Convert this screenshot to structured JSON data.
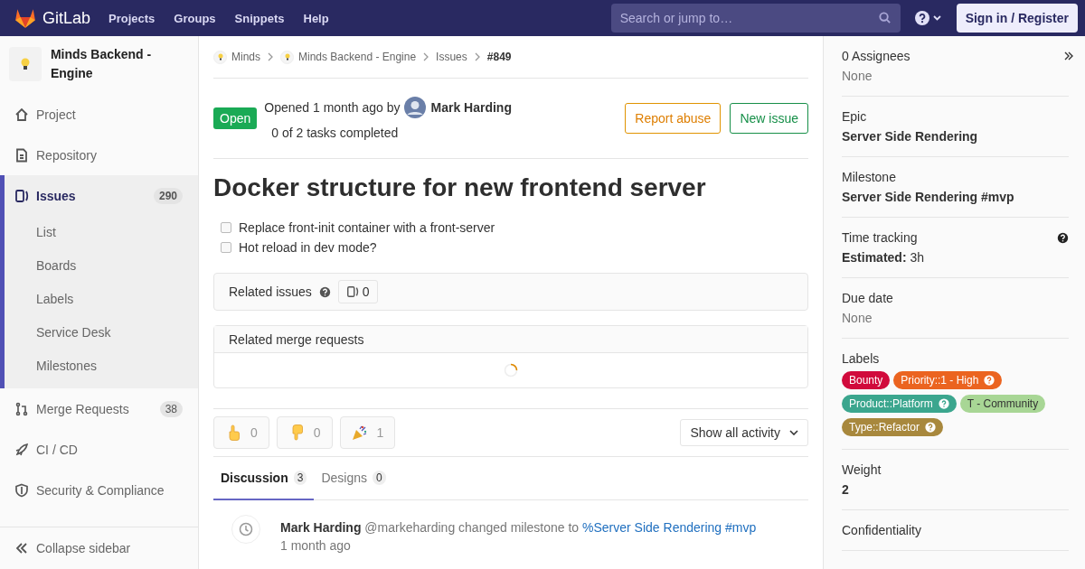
{
  "navbar": {
    "brand": "GitLab",
    "links": [
      "Projects",
      "Groups",
      "Snippets",
      "Help"
    ],
    "search": {
      "placeholder": "Search or jump to…"
    },
    "sign_in": "Sign in / Register"
  },
  "sidebar": {
    "project": "Minds Backend - Engine",
    "items": [
      {
        "label": "Project",
        "kind": "home",
        "selected": false
      },
      {
        "label": "Repository",
        "kind": "doc",
        "selected": false
      },
      {
        "label": "Issues",
        "kind": "issues",
        "selected": true,
        "count": "290",
        "children": [
          {
            "label": "List"
          },
          {
            "label": "Boards"
          },
          {
            "label": "Labels"
          },
          {
            "label": "Service Desk"
          },
          {
            "label": "Milestones"
          }
        ]
      },
      {
        "label": "Merge Requests",
        "kind": "merge",
        "selected": false,
        "count": "38"
      },
      {
        "label": "CI / CD",
        "kind": "rocket",
        "selected": false
      },
      {
        "label": "Security & Compliance",
        "kind": "shield",
        "selected": false
      }
    ],
    "collapse": "Collapse sidebar"
  },
  "breadcrumbs": [
    {
      "label": "Minds",
      "avatar": true
    },
    {
      "label": "Minds Backend - Engine",
      "avatar": true
    },
    {
      "label": "Issues",
      "avatar": false
    },
    {
      "label": "#849",
      "avatar": false
    }
  ],
  "issue": {
    "status": "Open",
    "opened": "Opened 1 month ago by",
    "author": "Mark Harding",
    "tasks_summary": "0 of 2 tasks completed",
    "buttons": [
      {
        "label": "Report abuse",
        "kind": "warning"
      },
      {
        "label": "New issue",
        "kind": "success"
      }
    ],
    "title": "Docker structure for new frontend server",
    "tasks": [
      {
        "label": "Replace front-init container with a front-server",
        "checked": false
      },
      {
        "label": "Hot reload in dev mode?",
        "checked": false
      }
    ]
  },
  "related_issues": {
    "title": "Related issues",
    "count": "0"
  },
  "related_merge_requests": {
    "title": "Related merge requests",
    "loading": true
  },
  "awards": [
    {
      "kind": "thumbsup",
      "count": "0"
    },
    {
      "kind": "thumbsdown",
      "count": "0"
    },
    {
      "kind": "tada",
      "count": "1"
    }
  ],
  "activity_filter": "Show all activity",
  "tabs": [
    {
      "label": "Discussion",
      "count": "3",
      "selected": true
    },
    {
      "label": "Designs",
      "count": "0",
      "selected": false
    }
  ],
  "timeline": [
    {
      "author": "Mark Harding",
      "action": "@markeharding changed milestone to",
      "link": "%Server Side Rendering #mvp",
      "time": "1 month ago"
    }
  ],
  "right_sidebar": [
    {
      "title": "0 Assignees",
      "kind": "none",
      "value": "None"
    },
    {
      "title": "Epic",
      "kind": "bold",
      "value": "Server Side Rendering"
    },
    {
      "title": "Milestone",
      "kind": "bold",
      "value": "Server Side Rendering #mvp"
    },
    {
      "title": "Time tracking",
      "kind": "rich",
      "value": "**Estimated:** 3h"
    },
    {
      "title": "Due date",
      "kind": "none",
      "value": "None"
    },
    {
      "title": "Labels",
      "kind": "labels",
      "labels": [
        {
          "text": "Bounty",
          "color": "#d10a3c",
          "scoped": false
        },
        {
          "text": "Priority::1 - High",
          "color": "#eb6420",
          "scoped": true
        },
        {
          "text": "Product::Platform",
          "color": "#3ba68e",
          "scoped": true
        },
        {
          "text": "T - Community",
          "color": "#a8d695",
          "scoped": false
        },
        {
          "text": "Type::Refactor",
          "color": "#a8883d",
          "scoped": true
        }
      ]
    },
    {
      "title": "Weight",
      "kind": "bold",
      "value": "2"
    },
    {
      "title": "Confidentiality",
      "kind": "title"
    }
  ]
}
